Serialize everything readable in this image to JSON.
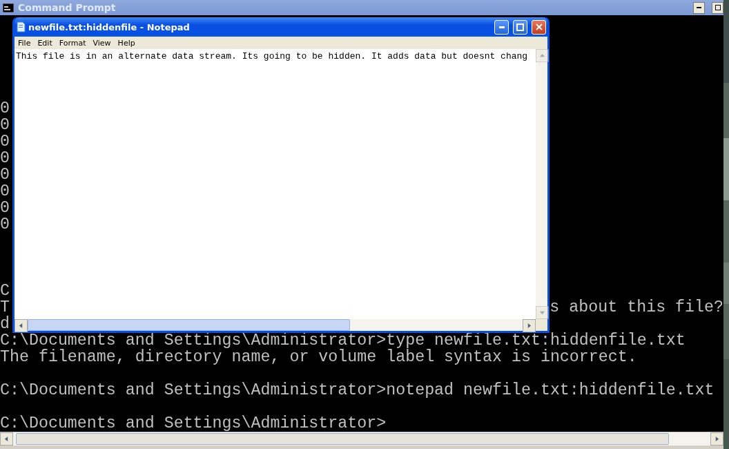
{
  "console": {
    "title": "Command Prompt",
    "lines": [
      {
        "kind": "blank"
      },
      {
        "kind": "blank"
      },
      {
        "kind": "blank"
      },
      {
        "kind": "blank"
      },
      {
        "kind": "blank"
      },
      {
        "kind": "text",
        "text": "0"
      },
      {
        "kind": "text",
        "text": "0"
      },
      {
        "kind": "text",
        "text": "0"
      },
      {
        "kind": "text",
        "text": "0"
      },
      {
        "kind": "text",
        "text": "0"
      },
      {
        "kind": "text",
        "text": "0"
      },
      {
        "kind": "text",
        "text": "0"
      },
      {
        "kind": "text",
        "text": "0"
      },
      {
        "kind": "blank"
      },
      {
        "kind": "blank"
      },
      {
        "kind": "blank"
      },
      {
        "kind": "text",
        "text": "C"
      },
      {
        "kind": "split",
        "text": "T",
        "right": "s about this file?"
      },
      {
        "kind": "text",
        "text": "d"
      },
      {
        "kind": "text",
        "text": "C:\\Documents and Settings\\Administrator>type newfile.txt:hiddenfile.txt"
      },
      {
        "kind": "text",
        "text": "The filename, directory name, or volume label syntax is incorrect."
      },
      {
        "kind": "blank"
      },
      {
        "kind": "text",
        "text": "C:\\Documents and Settings\\Administrator>notepad newfile.txt:hiddenfile.txt"
      },
      {
        "kind": "blank"
      },
      {
        "kind": "text",
        "text": "C:\\Documents and Settings\\Administrator>"
      }
    ]
  },
  "notepad": {
    "title": "newfile.txt:hiddenfile - Notepad",
    "menu": [
      "File",
      "Edit",
      "Format",
      "View",
      "Help"
    ],
    "text": "This file is in an alternate data stream. Its going to be hidden. It adds data but doesnt chang"
  }
}
